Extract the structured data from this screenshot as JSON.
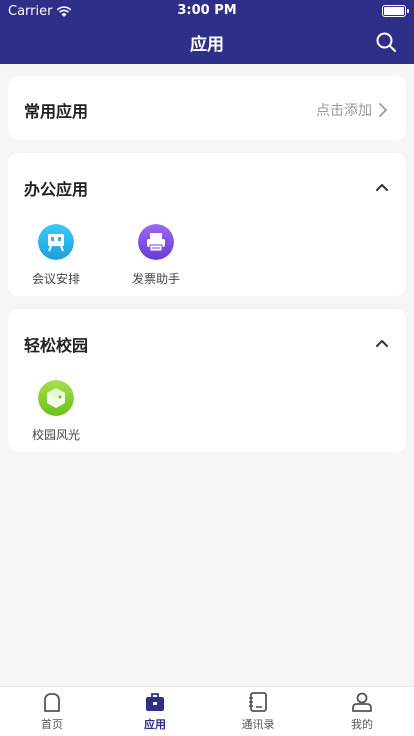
{
  "status": {
    "carrier": "Carrier",
    "time": "3:00 PM"
  },
  "header": {
    "title": "应用"
  },
  "sections": {
    "common": {
      "title": "常用应用",
      "add_label": "点击添加"
    },
    "office": {
      "title": "办公应用",
      "apps": [
        {
          "label": "会议安排",
          "icon": "meeting-icon"
        },
        {
          "label": "发票助手",
          "icon": "invoice-printer-icon"
        }
      ]
    },
    "campus": {
      "title": "轻松校园",
      "apps": [
        {
          "label": "校园风光",
          "icon": "campus-scenery-icon"
        }
      ]
    }
  },
  "tabbar": {
    "items": [
      {
        "label": "首页",
        "icon": "home-icon"
      },
      {
        "label": "应用",
        "icon": "briefcase-icon"
      },
      {
        "label": "通讯录",
        "icon": "contacts-book-icon"
      },
      {
        "label": "我的",
        "icon": "profile-icon"
      }
    ],
    "active_index": 1
  },
  "colors": {
    "primary": "#2f2f8a",
    "background": "#f5f5f5",
    "meeting": "#2bb6e8",
    "invoice": "#7a4ae0",
    "campus": "#8ad12b"
  }
}
